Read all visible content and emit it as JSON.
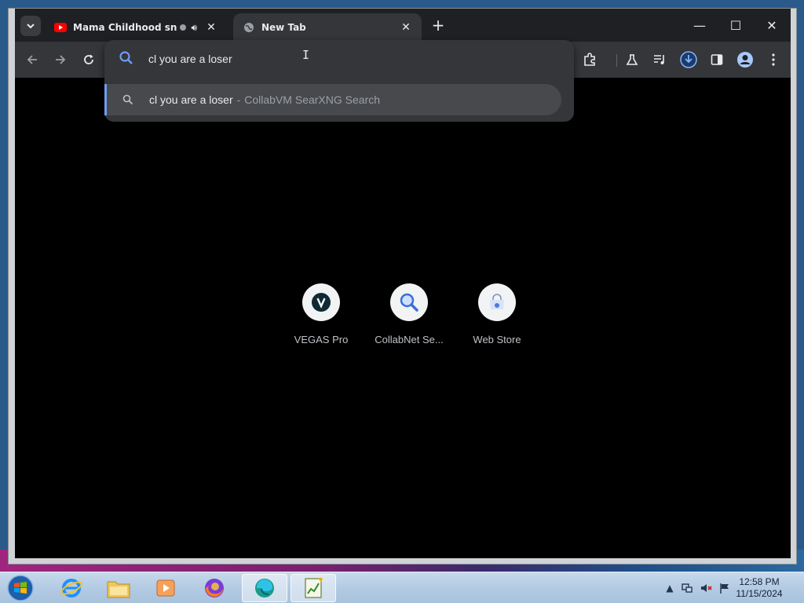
{
  "tabs": {
    "inactive": {
      "title": "Mama Childhood snacks",
      "close": "✕"
    },
    "active": {
      "title": "New Tab",
      "close": "✕"
    },
    "new_tab": "+"
  },
  "window_controls": {
    "minimize": "—",
    "maximize": "☐",
    "close": "✕"
  },
  "omnibox": {
    "value": "cl you are a loser",
    "suggestion_query": "cl you are a loser",
    "suggestion_separator": "-",
    "suggestion_engine": "CollabVM SearXNG Search"
  },
  "shortcuts": [
    {
      "label": "VEGAS Pro",
      "icon": "vegas-v-icon"
    },
    {
      "label": "CollabNet Se...",
      "icon": "magnifier-icon"
    },
    {
      "label": "Web Store",
      "icon": "web-store-icon"
    }
  ],
  "taskbar": {
    "time": "12:58 PM",
    "date": "11/15/2024",
    "items": [
      "start",
      "internet-explorer",
      "explorer",
      "media-player",
      "firefox",
      "edge",
      "notepad"
    ]
  },
  "colors": {
    "accent": "#6f9cf0",
    "tab_active": "#35363a",
    "tab_strip": "#1f2023",
    "page_bg": "#000000",
    "youtube_red": "#ff0000"
  }
}
